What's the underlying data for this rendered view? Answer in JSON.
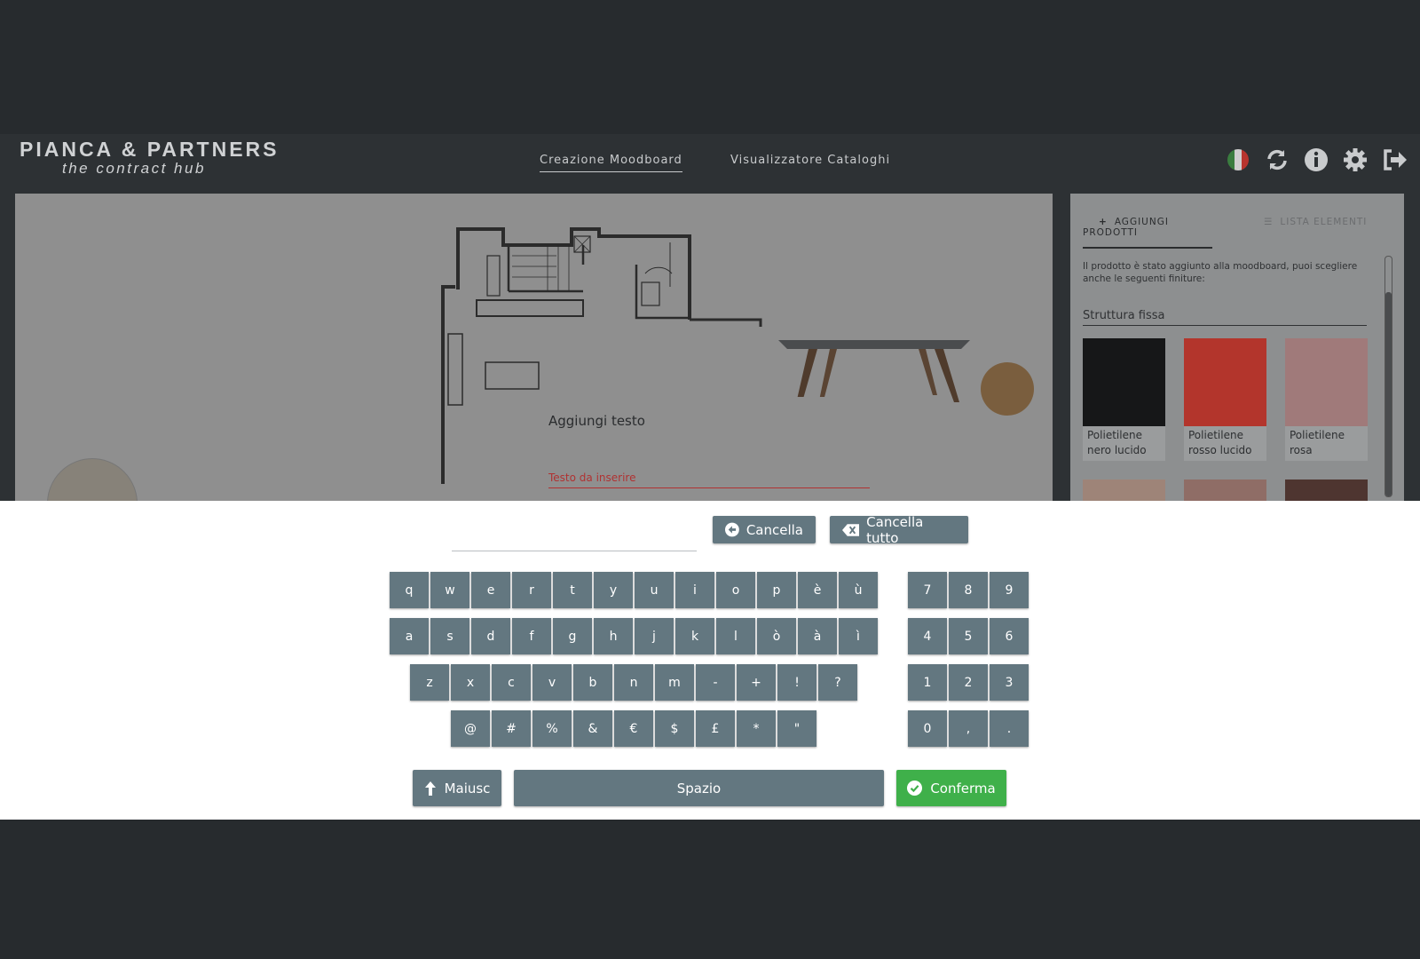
{
  "logo": {
    "main": "PIANCA & PARTNERS",
    "sub": "the contract hub"
  },
  "nav": [
    {
      "label": "Creazione Moodboard"
    },
    {
      "label": "Visualizzatore Cataloghi"
    }
  ],
  "header_icons": [
    "italy-flag-icon",
    "refresh-icon",
    "info-icon",
    "gear-icon",
    "logout-icon"
  ],
  "right_panel": {
    "tabs": [
      {
        "label": "AGGIUNGI PRODOTTI"
      },
      {
        "label": "LISTA ELEMENTI"
      }
    ],
    "info": "Il prodotto è stato aggiunto alla moodboard, puoi scegliere anche le seguenti finiture:",
    "section": "Struttura fissa",
    "swatches": [
      {
        "label": "Polietilene nero lucido",
        "color": "#161718"
      },
      {
        "label": "Polietilene rosso lucido",
        "color": "#b3352c"
      },
      {
        "label": "Polietilene rosa",
        "color": "#a07a7a"
      }
    ],
    "swatches_row2_colors": [
      "#9e8478",
      "#8f6d66",
      "#4e3530"
    ]
  },
  "dialog": {
    "title": "Aggiungi testo",
    "placeholder": "Testo da inserire"
  },
  "keyboard": {
    "input_value": "",
    "cancella_label": "Cancella",
    "cancella_tutto_label": "Cancella tutto",
    "rows": [
      [
        "q",
        "w",
        "e",
        "r",
        "t",
        "y",
        "u",
        "i",
        "o",
        "p",
        "è",
        "ù"
      ],
      [
        "a",
        "s",
        "d",
        "f",
        "g",
        "h",
        "j",
        "k",
        "l",
        "ò",
        "à",
        "ì"
      ],
      [
        "z",
        "x",
        "c",
        "v",
        "b",
        "n",
        "m",
        "-",
        "+",
        "!",
        "?"
      ],
      [
        "@",
        "#",
        "%",
        "&",
        "€",
        "$",
        "£",
        "*",
        "\""
      ]
    ],
    "numpad": [
      [
        "7",
        "8",
        "9"
      ],
      [
        "4",
        "5",
        "6"
      ],
      [
        "1",
        "2",
        "3"
      ],
      [
        "0",
        ",",
        "."
      ]
    ],
    "maiusc_label": "Maiusc",
    "spazio_label": "Spazio",
    "conferma_label": "Conferma",
    "key_color": "#637780",
    "confirm_color": "#3fb04a"
  }
}
